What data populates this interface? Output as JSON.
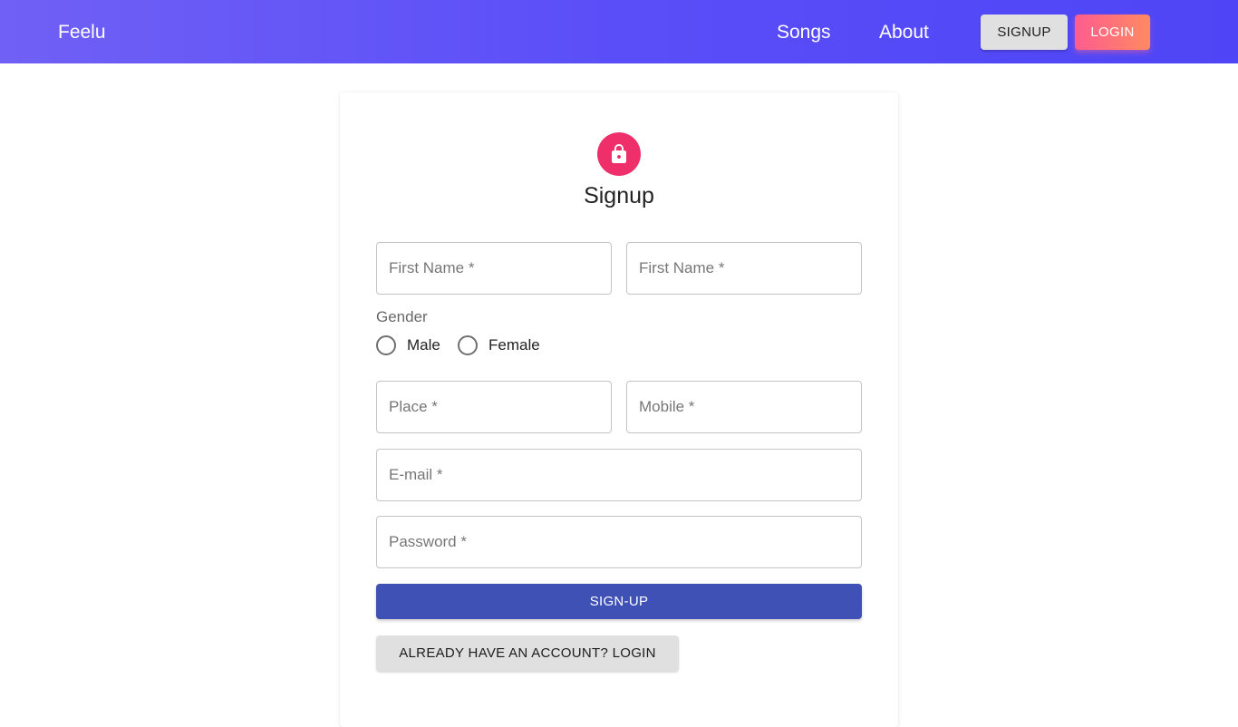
{
  "navbar": {
    "brand": "Feelu",
    "links": [
      {
        "label": "Songs"
      },
      {
        "label": "About"
      }
    ],
    "signup_label": "SIGNUP",
    "login_label": "LOGIN"
  },
  "form": {
    "icon": "lock-icon",
    "title": "Signup",
    "fields": {
      "first_name_1": {
        "placeholder": "First Name *",
        "value": ""
      },
      "first_name_2": {
        "placeholder": "First Name *",
        "value": ""
      },
      "place": {
        "placeholder": "Place *",
        "value": ""
      },
      "mobile": {
        "placeholder": "Mobile *",
        "value": ""
      },
      "email": {
        "placeholder": "E-mail *",
        "value": ""
      },
      "password": {
        "placeholder": "Password *",
        "value": ""
      }
    },
    "gender": {
      "label": "Gender",
      "options": [
        "Male",
        "Female"
      ]
    },
    "submit_label": "SIGN-UP",
    "login_link_label": "ALREADY HAVE AN ACCOUNT? LOGIN"
  },
  "colors": {
    "navbar_gradient_start": "#7060f5",
    "navbar_gradient_end": "#4f45f6",
    "avatar_bg": "#ee2f6a",
    "primary_button": "#3f51b5",
    "login_gradient_start": "#fe5c8e",
    "login_gradient_end": "#ff8a62"
  }
}
